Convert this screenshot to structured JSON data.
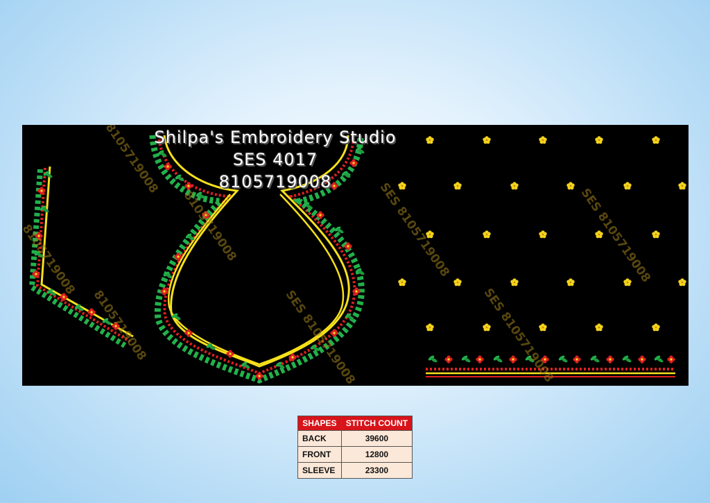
{
  "brand": {
    "studio": "Shilpa's Embroidery Studio",
    "code": "SES 4017",
    "phone": "8105719008"
  },
  "watermarks": [
    "SES 8105719008",
    "SES 8105719008",
    "SES 8105719008",
    "SES 8105719008",
    "8105719008",
    "8105719008",
    "8105719008",
    "8105719008"
  ],
  "colors": {
    "panel": "#000000",
    "outline": "#f7e11b",
    "bead": "#e02020",
    "leaf": "#22b14c",
    "flower": "#f2d21b",
    "table_header": "#d7141a",
    "table_cell": "#fce8d8"
  },
  "table": {
    "headers": [
      "SHAPES",
      "STITCH COUNT"
    ],
    "rows": [
      {
        "shape": "BACK",
        "count": "39600"
      },
      {
        "shape": "FRONT",
        "count": "12800"
      },
      {
        "shape": "SLEEVE",
        "count": "23300"
      }
    ]
  }
}
